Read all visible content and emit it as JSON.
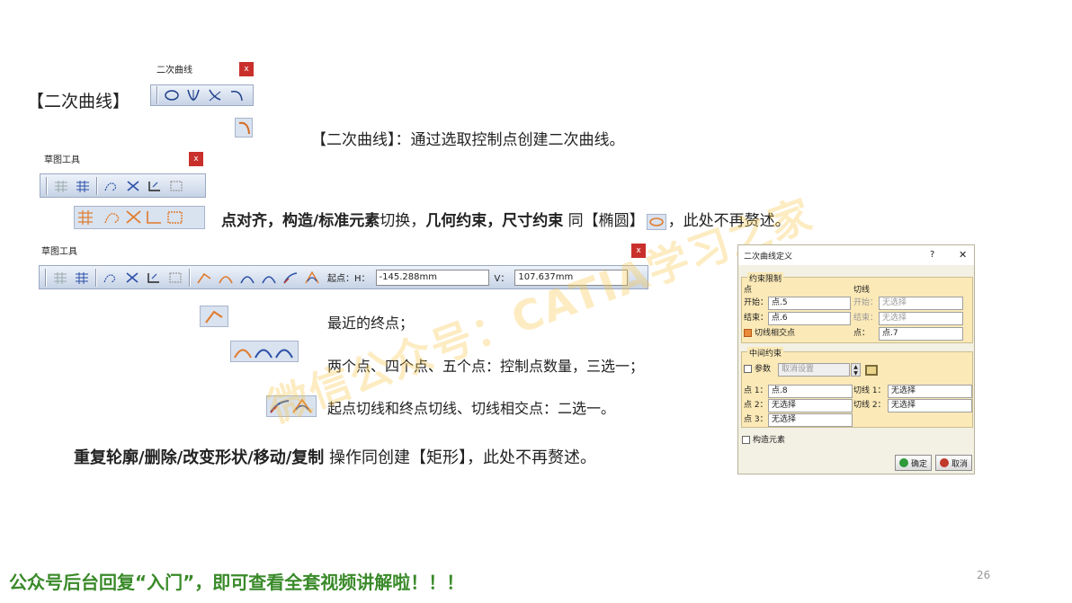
{
  "toolbar_conic": {
    "title": "二次曲线",
    "close": "x",
    "icons": [
      "ellipse-icon",
      "parabola-icon",
      "hyperbola-icon",
      "conic-icon"
    ]
  },
  "conic_label": "【二次曲线】",
  "conic_desc": "【二次曲线】：通过选取控制点创建二次曲线。",
  "sketch_tools": {
    "title": "草图工具",
    "close": "x"
  },
  "line_snap": {
    "p1": "点对齐，构造/标准元素",
    "p2": "切换，",
    "p3": "几何约束，尺寸约束",
    "p4": " 同【椭圆】",
    "p5": "，此处不再赘述。"
  },
  "sketch_tools_full": {
    "title": "草图工具",
    "close": "x",
    "start_label": "起点：H：",
    "h_value": "-145.288mm",
    "v_label": "V：",
    "v_value": "107.637mm"
  },
  "explain": {
    "recent": "最近的终点；",
    "points": "两个点、四个点、五个点：控制点数量，三选一；",
    "tangent": "起点切线和终点切线、切线相交点：二选一。"
  },
  "repeat": {
    "bold": "重复轮廓/删除/改变形状/移动/复制",
    "rest": " 操作同创建【矩形】，此处不再赘述。"
  },
  "watermark": "微信公众号：CATIA学习之家",
  "dialog": {
    "title": "二次曲线定义",
    "help": "?",
    "close": "✕",
    "group1": "约束限制",
    "col_point": "点",
    "col_tangent": "切线",
    "start_lbl": "开始：",
    "start_val": "点.5",
    "end_lbl": "结束：",
    "end_val": "点.6",
    "t_start_lbl": "开始：",
    "t_start_val": "无选择",
    "t_end_lbl": "结束：",
    "t_end_val": "无选择",
    "tan_intersect": "切线相交点",
    "pt_lbl": "点：",
    "pt_val": "点.7",
    "group2": "中间约束",
    "param": "参数",
    "param_val": "取消设置",
    "p1_lbl": "点 1：",
    "p1_val": "点.8",
    "p2_lbl": "点 2：",
    "p2_val": "无选择",
    "p3_lbl": "点 3：",
    "p3_val": "无选择",
    "tan1_lbl": "切线 1：",
    "tan1_val": "无选择",
    "tan2_lbl": "切线 2：",
    "tan2_val": "无选择",
    "construct": "构造元素",
    "ok": "确定",
    "cancel": "取消"
  },
  "footer": "公众号后台回复“入门”，即可查看全套视频讲解啦！！！",
  "page_number": "26",
  "colors": {
    "accent_orange": "#e88a3a",
    "footer_green": "#3a8a2a",
    "toolbar_blue": "#c6d3e6",
    "dialog_bg": "#f3f0e4"
  }
}
